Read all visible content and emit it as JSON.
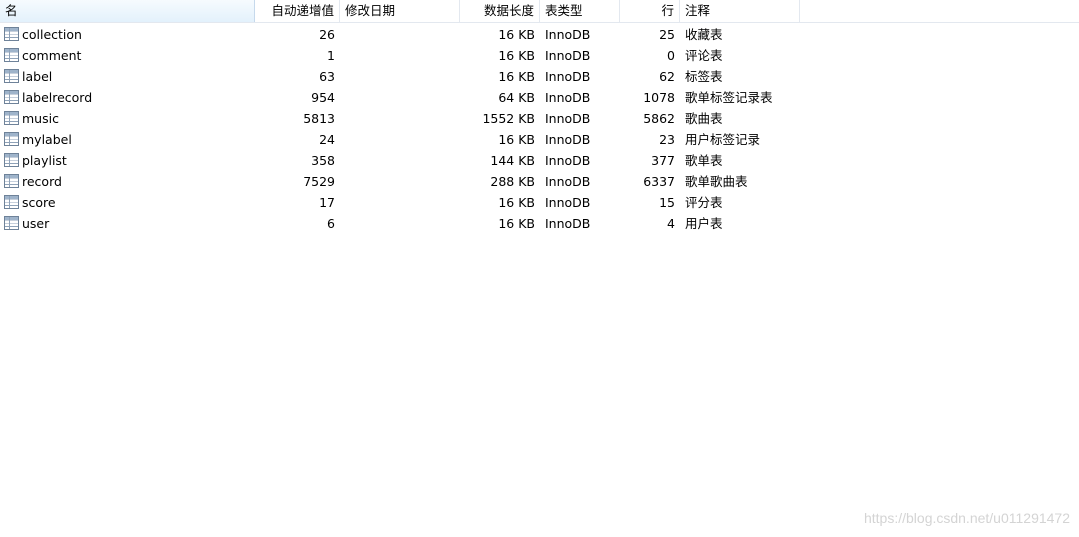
{
  "columns": {
    "name": "名",
    "auto_increment": "自动递增值",
    "modified": "修改日期",
    "data_length": "数据长度",
    "engine": "表类型",
    "rows": "行",
    "comment": "注释"
  },
  "sort": {
    "icon": "sort-ascending-icon",
    "glyph": "˄"
  },
  "tables": [
    {
      "name": "collection",
      "auto_increment": "26",
      "modified": "",
      "data_length": "16 KB",
      "engine": "InnoDB",
      "rows": "25",
      "comment": "收藏表"
    },
    {
      "name": "comment",
      "auto_increment": "1",
      "modified": "",
      "data_length": "16 KB",
      "engine": "InnoDB",
      "rows": "0",
      "comment": "评论表"
    },
    {
      "name": "label",
      "auto_increment": "63",
      "modified": "",
      "data_length": "16 KB",
      "engine": "InnoDB",
      "rows": "62",
      "comment": "标签表"
    },
    {
      "name": "labelrecord",
      "auto_increment": "954",
      "modified": "",
      "data_length": "64 KB",
      "engine": "InnoDB",
      "rows": "1078",
      "comment": "歌单标签记录表"
    },
    {
      "name": "music",
      "auto_increment": "5813",
      "modified": "",
      "data_length": "1552 KB",
      "engine": "InnoDB",
      "rows": "5862",
      "comment": "歌曲表"
    },
    {
      "name": "mylabel",
      "auto_increment": "24",
      "modified": "",
      "data_length": "16 KB",
      "engine": "InnoDB",
      "rows": "23",
      "comment": "用户标签记录"
    },
    {
      "name": "playlist",
      "auto_increment": "358",
      "modified": "",
      "data_length": "144 KB",
      "engine": "InnoDB",
      "rows": "377",
      "comment": "歌单表"
    },
    {
      "name": "record",
      "auto_increment": "7529",
      "modified": "",
      "data_length": "288 KB",
      "engine": "InnoDB",
      "rows": "6337",
      "comment": "歌单歌曲表"
    },
    {
      "name": "score",
      "auto_increment": "17",
      "modified": "",
      "data_length": "16 KB",
      "engine": "InnoDB",
      "rows": "15",
      "comment": "评分表"
    },
    {
      "name": "user",
      "auto_increment": "6",
      "modified": "",
      "data_length": "16 KB",
      "engine": "InnoDB",
      "rows": "4",
      "comment": "用户表"
    }
  ],
  "icons": {
    "table": "table-icon"
  },
  "watermark": "https://blog.csdn.net/u011291472"
}
